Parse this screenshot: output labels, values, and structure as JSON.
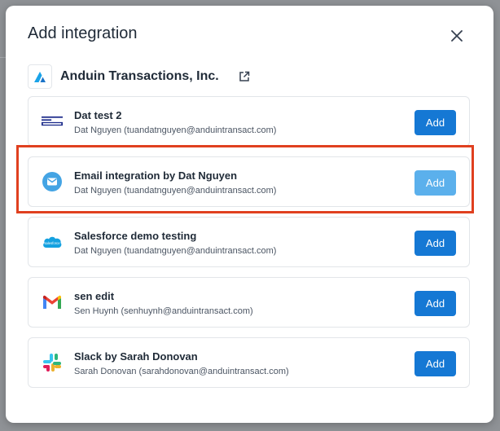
{
  "modal": {
    "title": "Add integration",
    "close_icon": "close-icon"
  },
  "org": {
    "name": "Anduin Transactions, Inc.",
    "logo_icon": "anduin-logo-icon",
    "external_link_icon": "external-link-icon"
  },
  "integrations": [
    {
      "name": "Dat test 2",
      "owner": "Dat Nguyen (tuandatnguyen@anduintransact.com)",
      "icon": "dat-test-logo-icon",
      "button": "Add",
      "disabled": false
    },
    {
      "name": "Email integration by Dat Nguyen",
      "owner": "Dat Nguyen (tuandatnguyen@anduintransact.com)",
      "icon": "email-icon",
      "button": "Add",
      "disabled": true
    },
    {
      "name": "Salesforce demo testing",
      "owner": "Dat Nguyen (tuandatnguyen@anduintransact.com)",
      "icon": "salesforce-icon",
      "button": "Add",
      "disabled": false
    },
    {
      "name": "sen edit",
      "owner": "Sen Huynh (senhuynh@anduintransact.com)",
      "icon": "gmail-icon",
      "button": "Add",
      "disabled": false
    },
    {
      "name": "Slack by Sarah Donovan",
      "owner": "Sarah Donovan (sarahdonovan@anduintransact.com)",
      "icon": "slack-icon",
      "button": "Add",
      "disabled": false
    }
  ],
  "colors": {
    "primary_button": "#1578d4",
    "disabled_button": "#5bb0ec",
    "highlight_border": "#e0401f"
  }
}
